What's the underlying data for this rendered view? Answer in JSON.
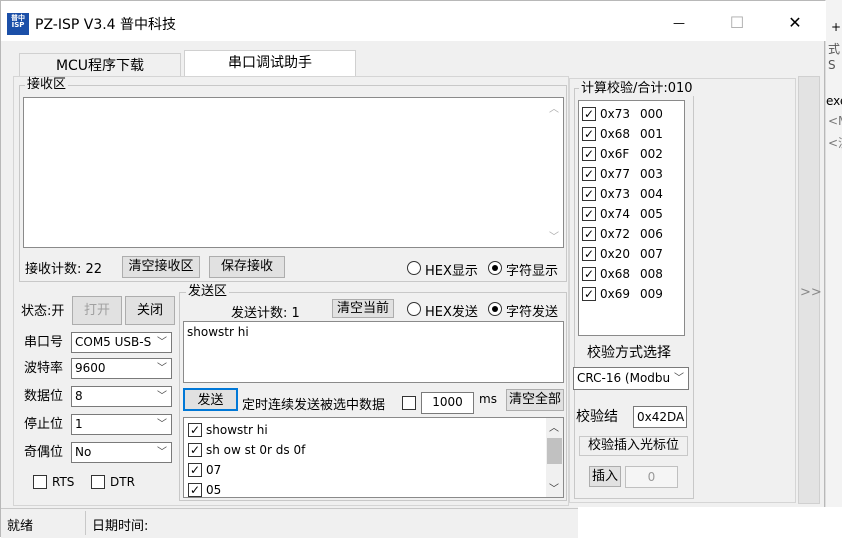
{
  "window": {
    "app_icon_text": "普中ISP",
    "title": "PZ-ISP V3.4 普中科技",
    "minimize": "—",
    "maximize": "☐",
    "close": "✕"
  },
  "tabs": [
    {
      "label": "MCU程序下载",
      "active": false
    },
    {
      "label": "串口调试助手",
      "active": true
    }
  ],
  "receive": {
    "legend": "接收区",
    "count_label": "接收计数: 22",
    "clear_button": "清空接收区",
    "save_button": "保存接收",
    "hex_display": "HEX显示",
    "char_display": "字符显示",
    "selected_mode": "char"
  },
  "status_panel": {
    "status_label": "状态:开",
    "open_button": "打开",
    "close_button": "关闭",
    "port_label": "串口号",
    "port_value": "COM5  USB-S",
    "baud_label": "波特率",
    "baud_value": "9600",
    "data_bits_label": "数据位",
    "data_bits_value": "8",
    "stop_bits_label": "停止位",
    "stop_bits_value": "1",
    "parity_label": "奇偶位",
    "parity_value": "No",
    "rts_label": "RTS",
    "dtr_label": "DTR"
  },
  "send": {
    "legend": "发送区",
    "count_label": "发送计数: 1",
    "clear_current": "清空当前",
    "hex_send": "HEX发送",
    "char_send": "字符发送",
    "selected_mode": "char",
    "text": "showstr hi",
    "send_button": "发送",
    "timer_label": "定时连续发送被选中数据",
    "interval_value": "1000",
    "interval_unit": "ms",
    "clear_all": "清空全部",
    "items": [
      "showstr hi",
      "sh ow st 0r ds 0f",
      "07",
      "05"
    ]
  },
  "checksum": {
    "legend": "计算校验/合计:010",
    "rows": [
      {
        "hex": "0x73",
        "idx": "000"
      },
      {
        "hex": "0x68",
        "idx": "001"
      },
      {
        "hex": "0x6F",
        "idx": "002"
      },
      {
        "hex": "0x77",
        "idx": "003"
      },
      {
        "hex": "0x73",
        "idx": "004"
      },
      {
        "hex": "0x74",
        "idx": "005"
      },
      {
        "hex": "0x72",
        "idx": "006"
      },
      {
        "hex": "0x20",
        "idx": "007"
      },
      {
        "hex": "0x68",
        "idx": "008"
      },
      {
        "hex": "0x69",
        "idx": "009"
      }
    ],
    "method_label": "校验方式选择",
    "method_value": "CRC-16 (Modbu",
    "result_label": "校验结",
    "result_value": "0x42DA",
    "insert_cursor": "校验插入光标位",
    "insert_button": "插入",
    "insert_value": "0"
  },
  "statusbar": {
    "ready": "就绪",
    "date_label": "日期时间:"
  },
  "side": {
    "expand_icon": ">>",
    "bg_text_1": "+",
    "bg_text_2": "式",
    "bg_text_3": "S",
    "bg_text_4": "exe",
    "bg_text_5": "<M",
    "bg_text_6": "<汉"
  }
}
